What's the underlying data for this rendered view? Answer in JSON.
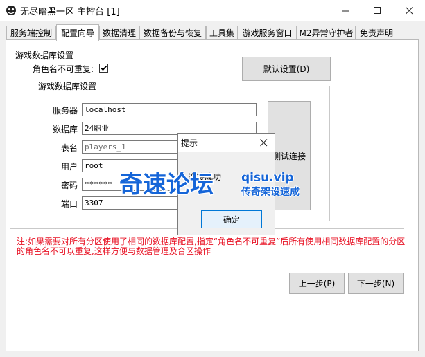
{
  "window": {
    "title": "无尽暗黑一区 主控台 [1]"
  },
  "tabs": [
    {
      "label": "服务端控制",
      "active": false
    },
    {
      "label": "配置向导",
      "active": true
    },
    {
      "label": "数据清理",
      "active": false
    },
    {
      "label": "数据备份与恢复",
      "active": false
    },
    {
      "label": "工具集",
      "active": false
    },
    {
      "label": "游戏服务窗口",
      "active": false
    },
    {
      "label": "M2异常守护者",
      "active": false
    },
    {
      "label": "免责声明",
      "active": false
    }
  ],
  "outer_group": {
    "label": "游戏数据库设置",
    "unique_name_label": "角色名不可重复:",
    "unique_name_checked": true,
    "default_button": "默认设置(D)"
  },
  "inner_group": {
    "label": "游戏数据库设置",
    "fields": [
      {
        "label": "服务器",
        "value": "localhost"
      },
      {
        "label": "数据库",
        "value": "24职业"
      },
      {
        "label": "表名",
        "value": "players_1"
      },
      {
        "label": "用户",
        "value": "root"
      },
      {
        "label": "密码",
        "value": "******"
      },
      {
        "label": "端口",
        "value": "3307"
      }
    ],
    "test_button": "测试连接"
  },
  "note": "注:如果需要对所有分区使用了相同的数据库配置,指定“角色名不可重复”后所有使用相同数据库配置的分区的角色名不可以重复,这样方便与数据管理及合区操作",
  "nav": {
    "prev": "上一步(P)",
    "next": "下一步(N)"
  },
  "dialog": {
    "title": "提示",
    "message": "连接成功",
    "ok": "确定"
  },
  "watermark": {
    "main": "奇速论坛",
    "domain": "qisu.vip",
    "slogan": "传奇架设速成"
  },
  "colors": {
    "note_red": "#e81123",
    "watermark_blue": "#1565d8",
    "focus_blue": "#0078d7"
  }
}
